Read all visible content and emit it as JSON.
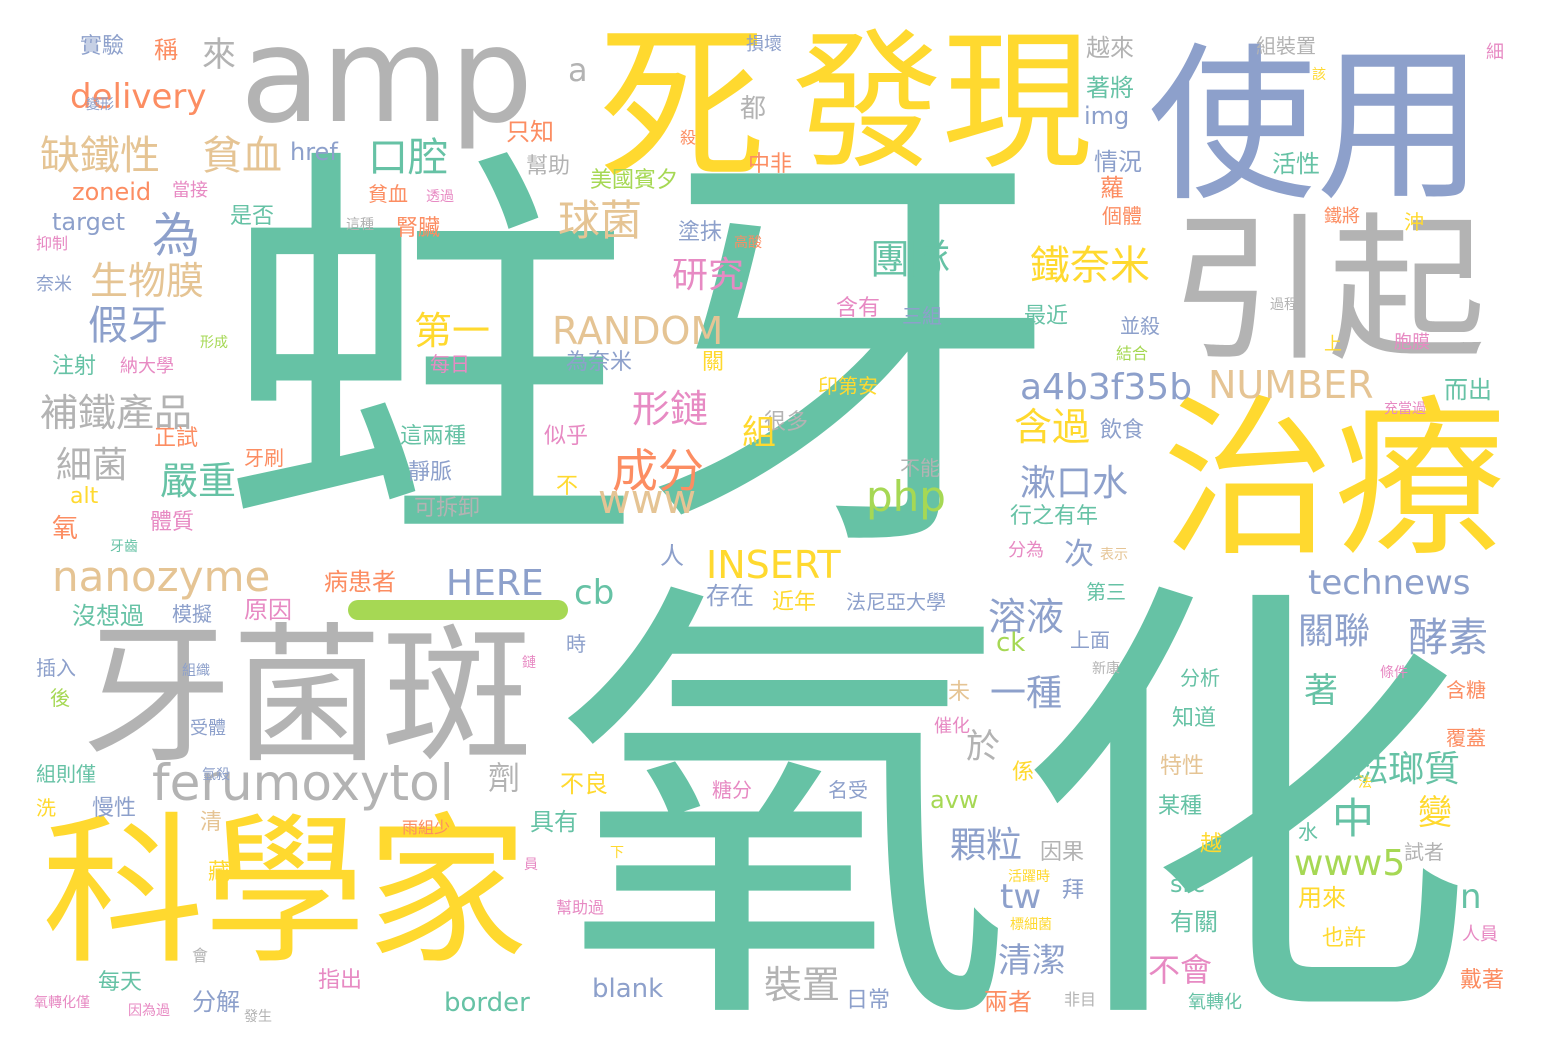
{
  "palette": {
    "teal": "#66c2a5",
    "yellow": "#ffd92f",
    "gray": "#b3b3b3",
    "blue": "#8da0cb",
    "orange": "#fc8d62",
    "green": "#a6d854",
    "pink": "#e78ac3",
    "tan": "#e5c494"
  },
  "words": [
    {
      "text": "蛀牙",
      "color": "teal"
    },
    {
      "text": "氧化",
      "color": "teal"
    },
    {
      "text": "amp",
      "color": "gray"
    },
    {
      "text": "死",
      "color": "yellow"
    },
    {
      "text": "發現",
      "color": "yellow"
    },
    {
      "text": "使用",
      "color": "blue"
    },
    {
      "text": "引起",
      "color": "gray"
    },
    {
      "text": "治療",
      "color": "yellow"
    },
    {
      "text": "牙菌斑",
      "color": "gray"
    },
    {
      "text": "科學家",
      "color": "yellow"
    },
    {
      "text": "ferumoxytol",
      "color": "gray"
    },
    {
      "text": "nanozyme",
      "color": "tan"
    },
    {
      "text": "缺鐵性",
      "color": "tan"
    },
    {
      "text": "貧血",
      "color": "tan"
    },
    {
      "text": "delivery",
      "color": "orange"
    },
    {
      "text": "假牙",
      "color": "blue"
    },
    {
      "text": "生物膜",
      "color": "tan"
    },
    {
      "text": "補鐵產品",
      "color": "gray"
    },
    {
      "text": "細菌",
      "color": "gray"
    },
    {
      "text": "嚴重",
      "color": "teal"
    },
    {
      "text": "球菌",
      "color": "tan"
    },
    {
      "text": "口腔",
      "color": "teal"
    },
    {
      "text": "為",
      "color": "blue"
    },
    {
      "text": "RANDOM",
      "color": "tan"
    },
    {
      "text": "NUMBER",
      "color": "tan"
    },
    {
      "text": "a4b3f35b",
      "color": "blue"
    },
    {
      "text": "成分",
      "color": "orange"
    },
    {
      "text": "形鏈",
      "color": "pink"
    },
    {
      "text": "研究",
      "color": "pink"
    },
    {
      "text": "團隊",
      "color": "teal"
    },
    {
      "text": "鐵奈米",
      "color": "yellow"
    },
    {
      "text": "第一",
      "color": "yellow"
    },
    {
      "text": "www",
      "color": "tan"
    },
    {
      "text": "php",
      "color": "green"
    },
    {
      "text": "INSERT",
      "color": "yellow"
    },
    {
      "text": "HERE",
      "color": "blue"
    },
    {
      "text": "technews",
      "color": "blue"
    },
    {
      "text": "酵素",
      "color": "blue"
    },
    {
      "text": "關聯",
      "color": "blue"
    },
    {
      "text": "含過",
      "color": "yellow"
    },
    {
      "text": "漱口水",
      "color": "blue"
    },
    {
      "text": "溶液",
      "color": "blue"
    },
    {
      "text": "一種",
      "color": "blue"
    },
    {
      "text": "中",
      "color": "teal"
    },
    {
      "text": "琺瑯質",
      "color": "teal"
    },
    {
      "text": "www5",
      "color": "green"
    },
    {
      "text": "清潔",
      "color": "blue"
    },
    {
      "text": "不會",
      "color": "pink"
    },
    {
      "text": "顆粒",
      "color": "blue"
    },
    {
      "text": "裝置",
      "color": "gray"
    },
    {
      "text": "cb",
      "color": "teal"
    },
    {
      "text": "tw",
      "color": "blue"
    },
    {
      "text": "n",
      "color": "teal"
    },
    {
      "text": "zoneid",
      "color": "orange"
    },
    {
      "text": "target",
      "color": "blue"
    },
    {
      "text": "href",
      "color": "blue"
    },
    {
      "text": "img",
      "color": "blue"
    },
    {
      "text": "ck",
      "color": "green"
    },
    {
      "text": "src",
      "color": "teal"
    },
    {
      "text": "avw",
      "color": "green"
    },
    {
      "text": "blank",
      "color": "blue"
    },
    {
      "text": "border",
      "color": "teal"
    },
    {
      "text": "alt",
      "color": "yellow"
    },
    {
      "text": "a",
      "color": "gray"
    },
    {
      "text": "來",
      "color": "gray"
    },
    {
      "text": "實驗",
      "color": "blue"
    },
    {
      "text": "稱",
      "color": "orange"
    },
    {
      "text": "只知",
      "color": "orange"
    },
    {
      "text": "幫助",
      "color": "gray"
    },
    {
      "text": "美國賓夕",
      "color": "green"
    },
    {
      "text": "中非",
      "color": "orange"
    },
    {
      "text": "都",
      "color": "gray"
    },
    {
      "text": "著將",
      "color": "teal"
    },
    {
      "text": "越來",
      "color": "gray"
    },
    {
      "text": "情況",
      "color": "blue"
    },
    {
      "text": "活性",
      "color": "teal"
    },
    {
      "text": "組裝置",
      "color": "gray"
    },
    {
      "text": "損壞",
      "color": "blue"
    },
    {
      "text": "細",
      "color": "pink"
    },
    {
      "text": "氧",
      "color": "orange"
    },
    {
      "text": "注射",
      "color": "teal"
    },
    {
      "text": "納大學",
      "color": "pink"
    },
    {
      "text": "正試",
      "color": "orange"
    },
    {
      "text": "牙刷",
      "color": "orange"
    },
    {
      "text": "體質",
      "color": "pink"
    },
    {
      "text": "病患者",
      "color": "orange"
    },
    {
      "text": "原因",
      "color": "pink"
    },
    {
      "text": "沒想過",
      "color": "teal"
    },
    {
      "text": "模擬",
      "color": "blue"
    },
    {
      "text": "存在",
      "color": "blue"
    },
    {
      "text": "近年",
      "color": "yellow"
    },
    {
      "text": "法尼亞大學",
      "color": "blue"
    },
    {
      "text": "次",
      "color": "blue"
    },
    {
      "text": "人",
      "color": "blue"
    },
    {
      "text": "慢性",
      "color": "blue"
    },
    {
      "text": "每天",
      "color": "teal"
    },
    {
      "text": "分解",
      "color": "blue"
    },
    {
      "text": "指出",
      "color": "pink"
    },
    {
      "text": "具有",
      "color": "teal"
    },
    {
      "text": "不良",
      "color": "yellow"
    },
    {
      "text": "日常",
      "color": "blue"
    },
    {
      "text": "兩者",
      "color": "orange"
    },
    {
      "text": "因果",
      "color": "gray"
    },
    {
      "text": "有關",
      "color": "teal"
    },
    {
      "text": "用來",
      "color": "yellow"
    },
    {
      "text": "也許",
      "color": "yellow"
    },
    {
      "text": "戴著",
      "color": "orange"
    },
    {
      "text": "後",
      "color": "green"
    },
    {
      "text": "插入",
      "color": "blue"
    },
    {
      "text": "組則僅",
      "color": "teal"
    },
    {
      "text": "洗",
      "color": "yellow"
    },
    {
      "text": "是否",
      "color": "teal"
    },
    {
      "text": "腎臟",
      "color": "orange"
    },
    {
      "text": "貧血",
      "color": "orange"
    },
    {
      "text": "塗抹",
      "color": "blue"
    },
    {
      "text": "最近",
      "color": "teal"
    },
    {
      "text": "並殺",
      "color": "blue"
    },
    {
      "text": "含有",
      "color": "pink"
    },
    {
      "text": "三組",
      "color": "blue"
    },
    {
      "text": "每日",
      "color": "pink"
    },
    {
      "text": "為奈米",
      "color": "blue"
    },
    {
      "text": "關",
      "color": "yellow"
    },
    {
      "text": "印第安",
      "color": "yellow"
    },
    {
      "text": "而出",
      "color": "teal"
    },
    {
      "text": "這兩種",
      "color": "teal"
    },
    {
      "text": "似乎",
      "color": "pink"
    },
    {
      "text": "很多",
      "color": "gray"
    },
    {
      "text": "飲食",
      "color": "blue"
    },
    {
      "text": "靜脈",
      "color": "blue"
    },
    {
      "text": "不",
      "color": "yellow"
    },
    {
      "text": "不能",
      "color": "gray"
    },
    {
      "text": "可拆卸",
      "color": "gray"
    },
    {
      "text": "行之有年",
      "color": "teal"
    },
    {
      "text": "劑",
      "color": "gray"
    },
    {
      "text": "於",
      "color": "gray"
    },
    {
      "text": "組",
      "color": "yellow"
    },
    {
      "text": "變",
      "color": "yellow"
    },
    {
      "text": "著",
      "color": "teal"
    },
    {
      "text": "知道",
      "color": "teal"
    },
    {
      "text": "特性",
      "color": "tan"
    },
    {
      "text": "某種",
      "color": "teal"
    },
    {
      "text": "越",
      "color": "yellow"
    },
    {
      "text": "上面",
      "color": "blue"
    },
    {
      "text": "第三",
      "color": "teal"
    },
    {
      "text": "分析",
      "color": "teal"
    },
    {
      "text": "含糖",
      "color": "orange"
    },
    {
      "text": "覆蓋",
      "color": "orange"
    },
    {
      "text": "係",
      "color": "yellow"
    },
    {
      "text": "清",
      "color": "tan"
    },
    {
      "text": "藏",
      "color": "yellow"
    },
    {
      "text": "未",
      "color": "tan"
    },
    {
      "text": "沖",
      "color": "yellow"
    },
    {
      "text": "上",
      "color": "yellow"
    },
    {
      "text": "水",
      "color": "teal"
    },
    {
      "text": "拜",
      "color": "blue"
    },
    {
      "text": "時",
      "color": "blue"
    },
    {
      "text": "名受",
      "color": "blue"
    },
    {
      "text": "糖分",
      "color": "pink"
    },
    {
      "text": "雨組少",
      "color": "orange"
    },
    {
      "text": "蘿",
      "color": "orange"
    },
    {
      "text": "個體",
      "color": "orange"
    },
    {
      "text": "鐵將",
      "color": "orange"
    },
    {
      "text": "殺",
      "color": "orange"
    },
    {
      "text": "當接",
      "color": "pink"
    },
    {
      "text": "抑制",
      "color": "pink"
    },
    {
      "text": "奈米",
      "color": "blue"
    },
    {
      "text": "形成",
      "color": "green"
    },
    {
      "text": "牙齒",
      "color": "teal"
    },
    {
      "text": "表示",
      "color": "tan"
    },
    {
      "text": "分為",
      "color": "pink"
    },
    {
      "text": "試者",
      "color": "gray"
    },
    {
      "text": "人員",
      "color": "pink"
    },
    {
      "text": "組織",
      "color": "blue"
    },
    {
      "text": "受體",
      "color": "blue"
    },
    {
      "text": "催化",
      "color": "pink"
    },
    {
      "text": "氫殺",
      "color": "blue"
    },
    {
      "text": "會",
      "color": "gray"
    },
    {
      "text": "氧轉化僅",
      "color": "pink"
    },
    {
      "text": "因為過",
      "color": "pink"
    },
    {
      "text": "發生",
      "color": "gray"
    },
    {
      "text": "非目",
      "color": "gray"
    },
    {
      "text": "氧轉化",
      "color": "teal"
    },
    {
      "text": "幫助過",
      "color": "pink"
    },
    {
      "text": "活躍時",
      "color": "yellow"
    },
    {
      "text": "標細菌",
      "color": "yellow"
    },
    {
      "text": "條件",
      "color": "pink"
    },
    {
      "text": "新康",
      "color": "gray"
    },
    {
      "text": "結合",
      "color": "green"
    },
    {
      "text": "胞膜",
      "color": "pink"
    },
    {
      "text": "充當過",
      "color": "pink"
    },
    {
      "text": "高酸",
      "color": "orange"
    },
    {
      "text": "這種",
      "color": "gray"
    },
    {
      "text": "透過",
      "color": "pink"
    },
    {
      "text": "過程",
      "color": "gray"
    },
    {
      "text": "變形",
      "color": "blue"
    },
    {
      "text": "該",
      "color": "yellow"
    },
    {
      "text": "法",
      "color": "yellow"
    },
    {
      "text": "鏈",
      "color": "pink"
    },
    {
      "text": "員",
      "color": "pink"
    },
    {
      "text": "下",
      "color": "yellow"
    }
  ]
}
